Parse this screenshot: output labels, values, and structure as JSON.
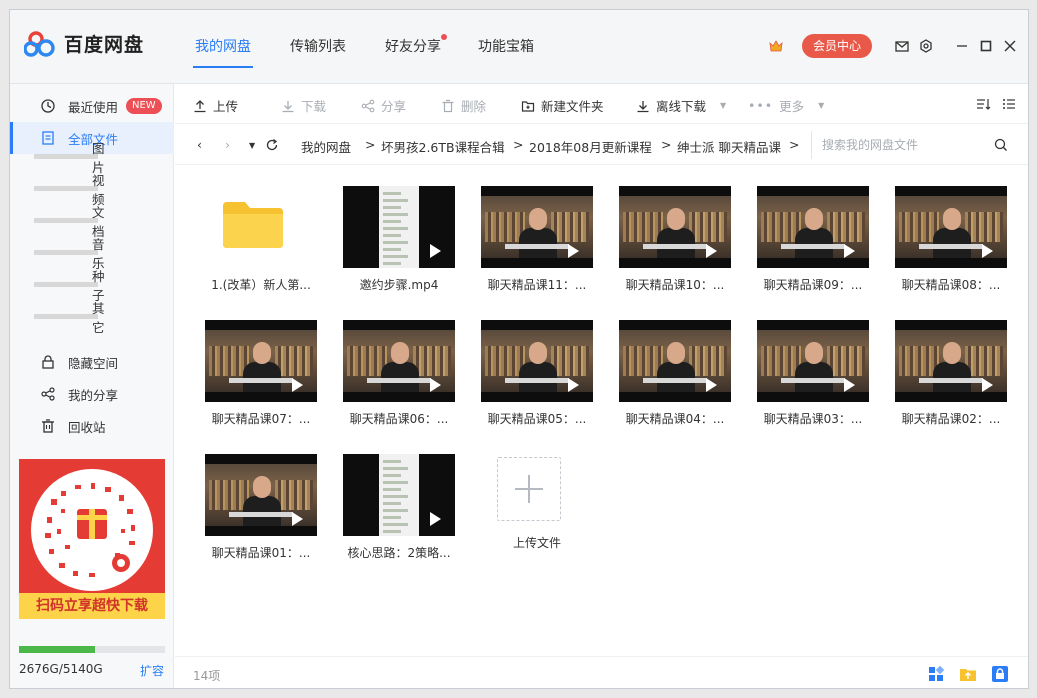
{
  "app": {
    "name": "百度网盘"
  },
  "tabs": [
    {
      "label": "我的网盘",
      "active": true
    },
    {
      "label": "传输列表"
    },
    {
      "label": "好友分享",
      "dot": true
    },
    {
      "label": "功能宝箱"
    }
  ],
  "header": {
    "vip_label": "会员中心"
  },
  "sidebar": {
    "items": [
      {
        "label": "最近使用",
        "icon": "clock-icon",
        "badge": "NEW"
      },
      {
        "label": "全部文件",
        "icon": "document-icon",
        "active": true
      },
      {
        "label": "图片"
      },
      {
        "label": "视频"
      },
      {
        "label": "文档"
      },
      {
        "label": "音乐"
      },
      {
        "label": "种子"
      },
      {
        "label": "其它"
      },
      {
        "label": "隐藏空间",
        "icon": "lock-icon"
      },
      {
        "label": "我的分享",
        "icon": "share-icon"
      },
      {
        "label": "回收站",
        "icon": "trash-icon"
      }
    ],
    "promo_text": "扫码立享超快下载",
    "quota_text": "2676G/5140G",
    "quota_fraction": 0.52,
    "expand_label": "扩容"
  },
  "toolbar": {
    "upload": "上传",
    "download": "下载",
    "share": "分享",
    "delete": "删除",
    "new_folder": "新建文件夹",
    "offline": "离线下载",
    "more": "更多"
  },
  "path": {
    "crumbs": [
      "我的网盘",
      "坏男孩2.6TB课程合辑",
      "2018年08月更新课程",
      "绅士派 聊天精品课"
    ],
    "separator": ">",
    "search_placeholder": "搜索我的网盘文件"
  },
  "files": [
    {
      "name": "1.(改革）新人第...",
      "type": "folder"
    },
    {
      "name": "邀约步骤.mp4",
      "type": "chat"
    },
    {
      "name": "聊天精品课11：...",
      "type": "video"
    },
    {
      "name": "聊天精品课10：...",
      "type": "video"
    },
    {
      "name": "聊天精品课09：...",
      "type": "video"
    },
    {
      "name": "聊天精品课08：...",
      "type": "video"
    },
    {
      "name": "聊天精品课07：...",
      "type": "video"
    },
    {
      "name": "聊天精品课06：...",
      "type": "video"
    },
    {
      "name": "聊天精品课05：...",
      "type": "video"
    },
    {
      "name": "聊天精品课04：...",
      "type": "video"
    },
    {
      "name": "聊天精品课03：...",
      "type": "video"
    },
    {
      "name": "聊天精品课02：...",
      "type": "video"
    },
    {
      "name": "聊天精品课01：...",
      "type": "video"
    },
    {
      "name": "核心思路：2策略...",
      "type": "chat"
    },
    {
      "name": "上传文件",
      "type": "upload"
    }
  ],
  "status": {
    "count": "14项"
  },
  "colors": {
    "accent": "#2b7df7",
    "vip": "#e8594a",
    "quota": "#4cb84a",
    "promo": "#e53b35"
  }
}
